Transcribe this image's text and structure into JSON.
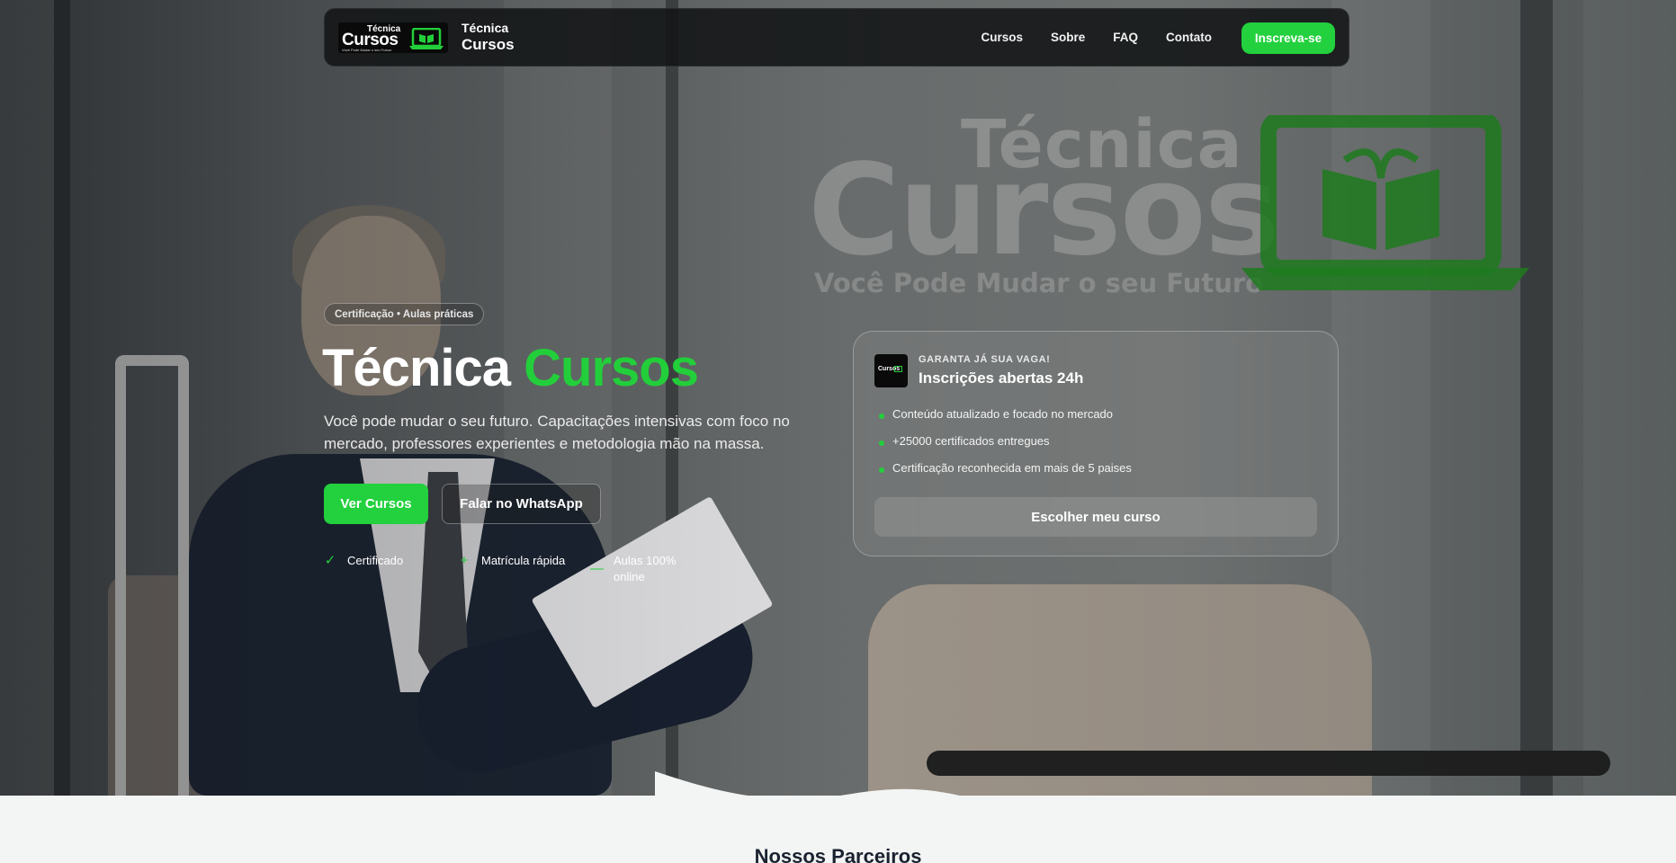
{
  "nav": {
    "logo": {
      "title_small": "Técnica",
      "title_big": "Cursos",
      "tagline": "Você Pode Mudar o seu Futuro",
      "icon": "book-laptop-icon"
    },
    "brand_line1": "Técnica",
    "brand_line2": "Cursos",
    "links": [
      "Cursos",
      "Sobre",
      "FAQ",
      "Contato"
    ],
    "cta": "Inscreva-se"
  },
  "watermark": {
    "line1": "Técnica",
    "line2": "Cursos",
    "tagline": "Você Pode Mudar o seu Futuro"
  },
  "hero": {
    "badge": "Certificação • Aulas práticas",
    "title_part1": "Técnica",
    "title_part2": "Cursos",
    "description": "Você pode mudar o seu futuro. Capacitações intensivas com foco no mercado, professores experientes e metodologia mão na massa.",
    "primary_button": "Ver Cursos",
    "secondary_button": "Falar no WhatsApp",
    "features": [
      {
        "icon": "check-icon",
        "glyph": "✓",
        "label": "Certificado"
      },
      {
        "icon": "plus-icon",
        "glyph": "+",
        "label": "Matrícula rápida"
      },
      {
        "icon": "minus-icon",
        "glyph": "—",
        "label": "Aulas 100% online"
      }
    ]
  },
  "card": {
    "logo_text": "Cursos",
    "kicker": "GARANTA JÁ SUA VAGA!",
    "title": "Inscrições abertas 24h",
    "items": [
      "Conteúdo atualizado e focado no mercado",
      "+25000 certificados entregues",
      "Certificação reconhecida em mais de 5 paises"
    ],
    "button": "Escolher meu curso"
  },
  "partners": {
    "title": "Nossos Parceiros"
  },
  "colors": {
    "accent": "#22d13d",
    "nav_bg": "#121416",
    "heading_dark": "#1a2230"
  }
}
